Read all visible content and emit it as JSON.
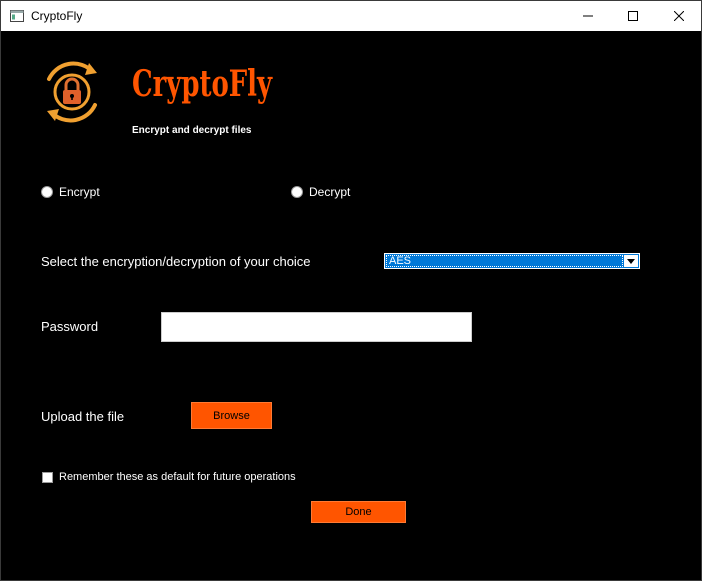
{
  "window": {
    "title": "CryptoFly"
  },
  "header": {
    "brand": "CryptoFly",
    "tagline": "Encrypt and decrypt files",
    "logo_icon": "lock-refresh-icon",
    "accent_color": "#ff5500"
  },
  "mode": {
    "encrypt_label": "Encrypt",
    "decrypt_label": "Decrypt",
    "selected": null
  },
  "algorithm": {
    "label": "Select the encryption/decryption of your choice",
    "selected": "AES"
  },
  "password": {
    "label": "Password",
    "value": ""
  },
  "upload": {
    "label": "Upload the file",
    "button_label": "Browse"
  },
  "remember": {
    "label": "Remember these as default for future operations",
    "checked": false
  },
  "actions": {
    "done_label": "Done"
  }
}
